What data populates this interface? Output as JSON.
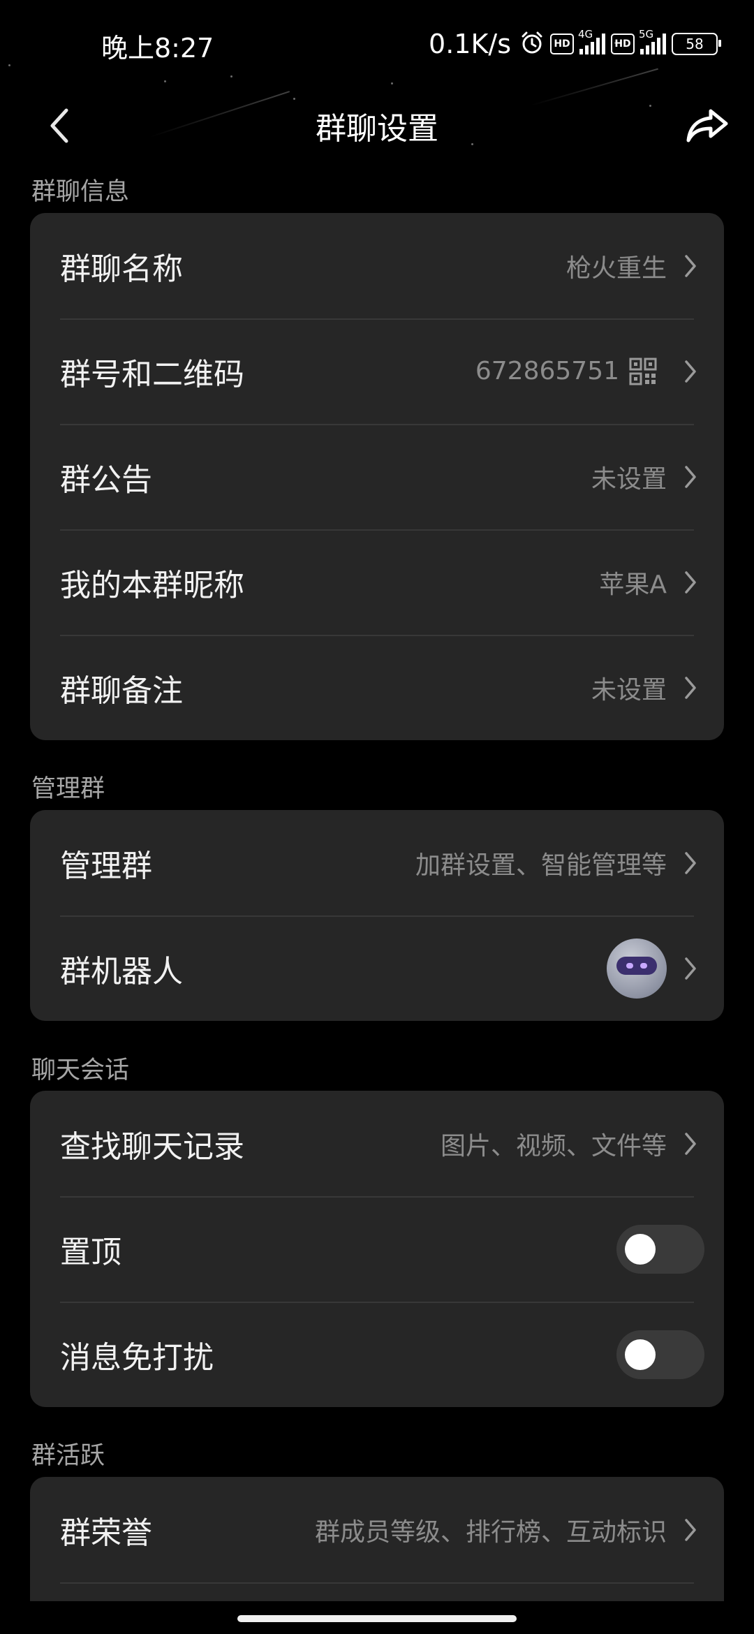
{
  "status_bar": {
    "time": "晚上8:27",
    "net_speed": "0.1K/s",
    "hd1": "HD",
    "gen1": "4G",
    "hd2": "HD",
    "gen2": "5G",
    "battery": "58"
  },
  "nav": {
    "title": "群聊设置"
  },
  "sections": {
    "info": {
      "label": "群聊信息",
      "rows": [
        {
          "title": "群聊名称",
          "value": "枪火重生"
        },
        {
          "title": "群号和二维码",
          "value": "672865751"
        },
        {
          "title": "群公告",
          "value": "未设置"
        },
        {
          "title": "我的本群昵称",
          "value": "苹果A"
        },
        {
          "title": "群聊备注",
          "value": "未设置"
        }
      ]
    },
    "manage": {
      "label": "管理群",
      "rows": [
        {
          "title": "管理群",
          "value": "加群设置、智能管理等"
        },
        {
          "title": "群机器人"
        }
      ]
    },
    "chat": {
      "label": "聊天会话",
      "rows": [
        {
          "title": "查找聊天记录",
          "value": "图片、视频、文件等"
        },
        {
          "title": "置顶",
          "toggle_on": false
        },
        {
          "title": "消息免打扰",
          "toggle_on": false
        }
      ]
    },
    "activity": {
      "label": "群活跃",
      "rows": [
        {
          "title": "群荣誉",
          "value": "群成员等级、排行榜、互动标识"
        }
      ]
    }
  },
  "colors": {
    "background": "#000000",
    "card": "#262626",
    "divider": "#383838",
    "secondary_text": "#8c8c8c",
    "section_label": "#a6a6a6",
    "toggle_off_track": "#3a3a3a"
  }
}
